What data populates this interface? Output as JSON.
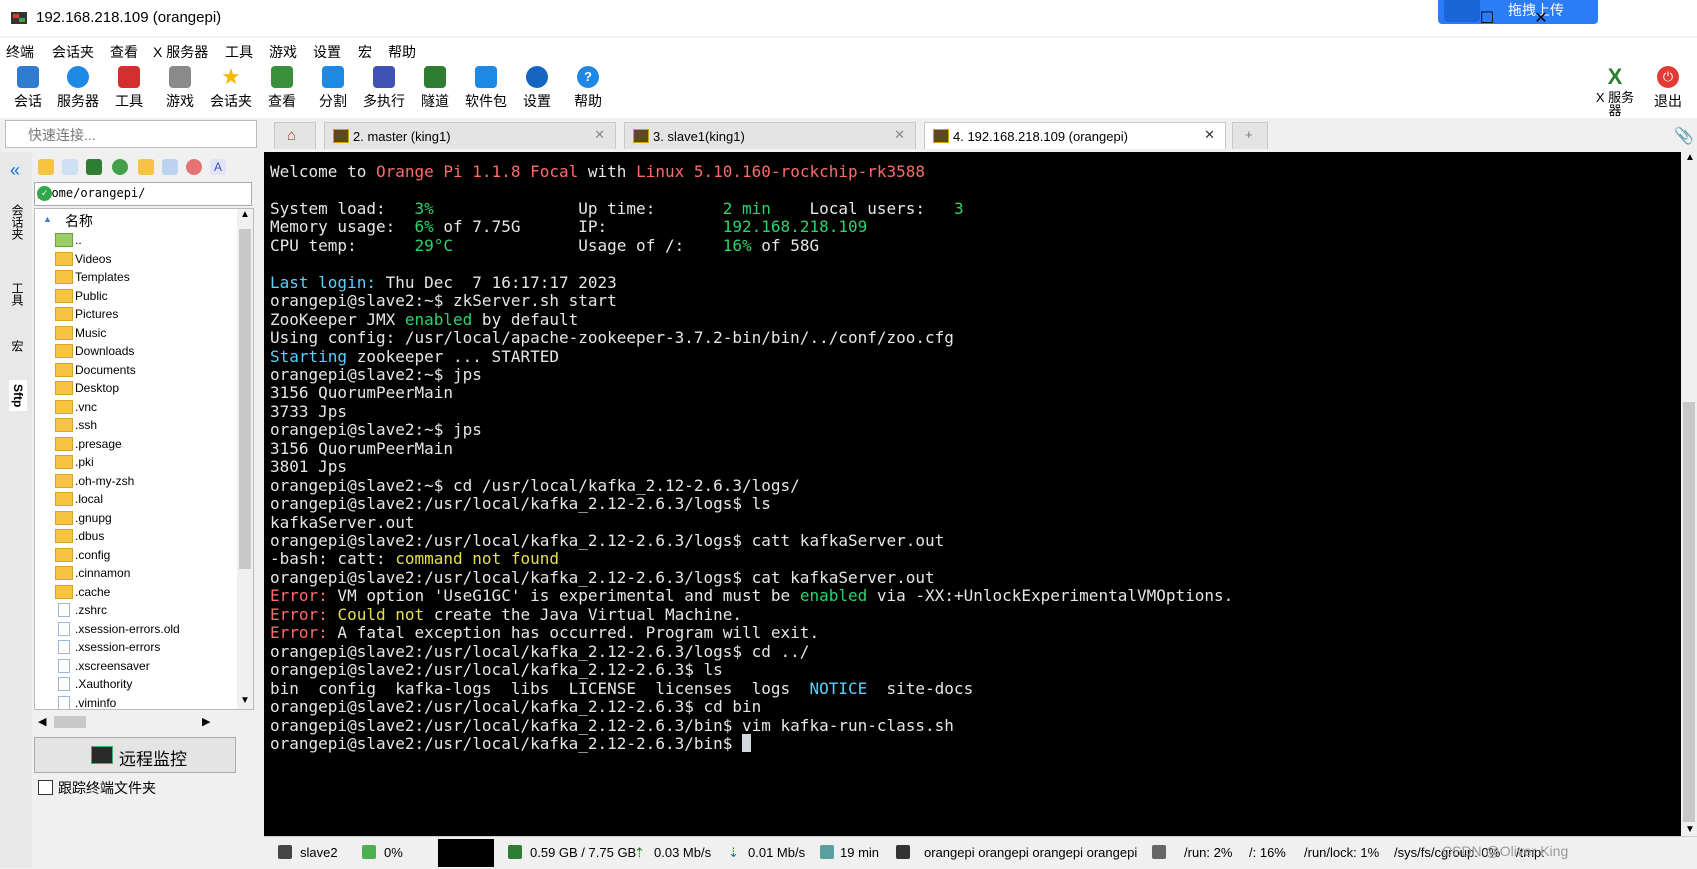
{
  "window": {
    "title": "192.168.218.109 (orangepi)",
    "upload_label": "拖拽上传",
    "minimize": "—",
    "maximize": "☐",
    "close": "✕"
  },
  "menu": [
    "终端",
    "会话夹",
    "查看",
    "X 服务器",
    "工具",
    "游戏",
    "设置",
    "宏",
    "帮助"
  ],
  "toolbar": {
    "items": [
      {
        "label": "会话",
        "icon": "session-icon",
        "color": "#2e7bcf"
      },
      {
        "label": "服务器",
        "icon": "servers-icon",
        "color": "#1e88e5"
      },
      {
        "label": "工具",
        "icon": "tools-icon",
        "color": "#d32f2f"
      },
      {
        "label": "游戏",
        "icon": "games-icon",
        "color": "#555555"
      },
      {
        "label": "会话夹",
        "icon": "star-icon",
        "color": "#f5b800"
      },
      {
        "label": "查看",
        "icon": "view-icon",
        "color": "#3b8f3b"
      },
      {
        "label": "分割",
        "icon": "split-icon",
        "color": "#1e88e5"
      },
      {
        "label": "多执行",
        "icon": "multiexec-icon",
        "color": "#3f51b5"
      },
      {
        "label": "隧道",
        "icon": "tunnel-icon",
        "color": "#2e7d32"
      },
      {
        "label": "软件包",
        "icon": "packages-icon",
        "color": "#1e88e5"
      },
      {
        "label": "设置",
        "icon": "settings-icon",
        "color": "#1565c0"
      },
      {
        "label": "帮助",
        "icon": "help-icon",
        "color": "#1e88e5"
      }
    ],
    "xserver_label": "X 服务器",
    "exit_label": "退出"
  },
  "quick_connect": {
    "placeholder": "快速连接..."
  },
  "tabs": [
    {
      "label": "2. master (king1)",
      "active": false
    },
    {
      "label": "3. slave1(king1)",
      "active": false
    },
    {
      "label": "4. 192.168.218.109 (orangepi)",
      "active": true
    }
  ],
  "side_strip": [
    "会话夹",
    "工具",
    "宏",
    "Sftp"
  ],
  "sftp": {
    "path": "/home/orangepi/",
    "column_header": "名称",
    "files": [
      {
        "name": "..",
        "type": "up"
      },
      {
        "name": "Videos",
        "type": "folder"
      },
      {
        "name": "Templates",
        "type": "folder"
      },
      {
        "name": "Public",
        "type": "folder"
      },
      {
        "name": "Pictures",
        "type": "folder"
      },
      {
        "name": "Music",
        "type": "folder"
      },
      {
        "name": "Downloads",
        "type": "folder"
      },
      {
        "name": "Documents",
        "type": "folder"
      },
      {
        "name": "Desktop",
        "type": "folder"
      },
      {
        "name": ".vnc",
        "type": "folder"
      },
      {
        "name": ".ssh",
        "type": "folder"
      },
      {
        "name": ".presage",
        "type": "folder"
      },
      {
        "name": ".pki",
        "type": "folder"
      },
      {
        "name": ".oh-my-zsh",
        "type": "folder"
      },
      {
        "name": ".local",
        "type": "folder"
      },
      {
        "name": ".gnupg",
        "type": "folder"
      },
      {
        "name": ".dbus",
        "type": "folder"
      },
      {
        "name": ".config",
        "type": "folder"
      },
      {
        "name": ".cinnamon",
        "type": "folder"
      },
      {
        "name": ".cache",
        "type": "folder"
      },
      {
        "name": ".zshrc",
        "type": "file"
      },
      {
        "name": ".xsession-errors.old",
        "type": "file"
      },
      {
        "name": ".xsession-errors",
        "type": "file"
      },
      {
        "name": ".xscreensaver",
        "type": "file"
      },
      {
        "name": ".Xauthority",
        "type": "file"
      },
      {
        "name": ".viminfo",
        "type": "file"
      }
    ],
    "remote_monitor": "远程监控",
    "follow_label": "跟踪终端文件夹"
  },
  "terminal": {
    "lines": [
      [
        [
          "Welcome to ",
          ""
        ],
        [
          "Orange Pi 1.1.8 Focal",
          "r"
        ],
        [
          " with ",
          ""
        ],
        [
          "Linux 5.10.160-rockchip-rk3588",
          "r"
        ]
      ],
      [],
      [
        [
          "System load:   ",
          ""
        ],
        [
          "3%",
          "g"
        ],
        [
          "               Up time:       ",
          ""
        ],
        [
          "2 min",
          "g"
        ],
        [
          "    Local users:   ",
          ""
        ],
        [
          "3",
          "g"
        ]
      ],
      [
        [
          "Memory usage:  ",
          ""
        ],
        [
          "6%",
          "g"
        ],
        [
          " of 7.75G      IP:            ",
          ""
        ],
        [
          "192.168.218.109",
          "g"
        ]
      ],
      [
        [
          "CPU temp:      ",
          ""
        ],
        [
          "29°C",
          "g"
        ],
        [
          "             Usage of /:    ",
          ""
        ],
        [
          "16%",
          "g"
        ],
        [
          " of 58G",
          ""
        ]
      ],
      [],
      [
        [
          "Last login:",
          "c"
        ],
        [
          " Thu Dec  7 16:17:17 2023",
          ""
        ]
      ],
      [
        [
          "orangepi@slave2:~$ zkServer.sh start",
          ""
        ]
      ],
      [
        [
          "ZooKeeper JMX ",
          ""
        ],
        [
          "enabled",
          "g"
        ],
        [
          " by default",
          ""
        ]
      ],
      [
        [
          "Using config: /usr/local/apache-zookeeper-3.7.2-bin/bin/../conf/zoo.cfg",
          ""
        ]
      ],
      [
        [
          "Starting",
          "c"
        ],
        [
          " zookeeper ... STARTED",
          ""
        ]
      ],
      [
        [
          "orangepi@slave2:~$ jps",
          ""
        ]
      ],
      [
        [
          "3156 QuorumPeerMain",
          ""
        ]
      ],
      [
        [
          "3733 Jps",
          ""
        ]
      ],
      [
        [
          "orangepi@slave2:~$ jps",
          ""
        ]
      ],
      [
        [
          "3156 QuorumPeerMain",
          ""
        ]
      ],
      [
        [
          "3801 Jps",
          ""
        ]
      ],
      [
        [
          "orangepi@slave2:~$ cd /usr/local/kafka_2.12-2.6.3/logs/",
          ""
        ]
      ],
      [
        [
          "orangepi@slave2:/usr/local/kafka_2.12-2.6.3/logs$ ls",
          ""
        ]
      ],
      [
        [
          "kafkaServer.out",
          ""
        ]
      ],
      [
        [
          "orangepi@slave2:/usr/local/kafka_2.12-2.6.3/logs$ catt kafkaServer.out",
          ""
        ]
      ],
      [
        [
          "-bash: catt: ",
          ""
        ],
        [
          "command not found",
          "y"
        ]
      ],
      [
        [
          "orangepi@slave2:/usr/local/kafka_2.12-2.6.3/logs$ cat kafkaServer.out",
          ""
        ]
      ],
      [
        [
          "Error:",
          "r"
        ],
        [
          " VM option 'UseG1GC' is experimental and must be ",
          ""
        ],
        [
          "enabled",
          "g"
        ],
        [
          " via -XX:+UnlockExperimentalVMOptions.",
          ""
        ]
      ],
      [
        [
          "Error:",
          "r"
        ],
        [
          " ",
          ""
        ],
        [
          "Could not",
          "y"
        ],
        [
          " create the Java Virtual Machine.",
          ""
        ]
      ],
      [
        [
          "Error:",
          "r"
        ],
        [
          " A fatal exception has occurred. Program will exit.",
          ""
        ]
      ],
      [
        [
          "orangepi@slave2:/usr/local/kafka_2.12-2.6.3/logs$ cd ../",
          ""
        ]
      ],
      [
        [
          "orangepi@slave2:/usr/local/kafka_2.12-2.6.3$ ls",
          ""
        ]
      ],
      [
        [
          "bin  config  kafka-logs  libs  LICENSE  licenses  logs  ",
          ""
        ],
        [
          "NOTICE",
          "c"
        ],
        [
          "  site-docs",
          ""
        ]
      ],
      [
        [
          "orangepi@slave2:/usr/local/kafka_2.12-2.6.3$ cd bin",
          ""
        ]
      ],
      [
        [
          "orangepi@slave2:/usr/local/kafka_2.12-2.6.3/bin$ vim kafka-run-class.sh",
          ""
        ]
      ],
      [
        [
          "orangepi@slave2:/usr/local/kafka_2.12-2.6.3/bin$ ",
          ""
        ]
      ]
    ]
  },
  "statusbar": {
    "host": "slave2",
    "cpu": "0%",
    "memory": "0.59 GB / 7.75 GB",
    "upload": "0.03 Mb/s",
    "download": "0.01 Mb/s",
    "uptime": "19 min",
    "users": "orangepi  orangepi  orangepi  orangepi",
    "run": "/run: 2%",
    "root": "/: 16%",
    "runlock": "/run/lock: 1%",
    "cgroup": "/sys/fs/cgroup: 0%",
    "tmp": "/tmp:",
    "watermark": "CSDN @Oliver King"
  }
}
